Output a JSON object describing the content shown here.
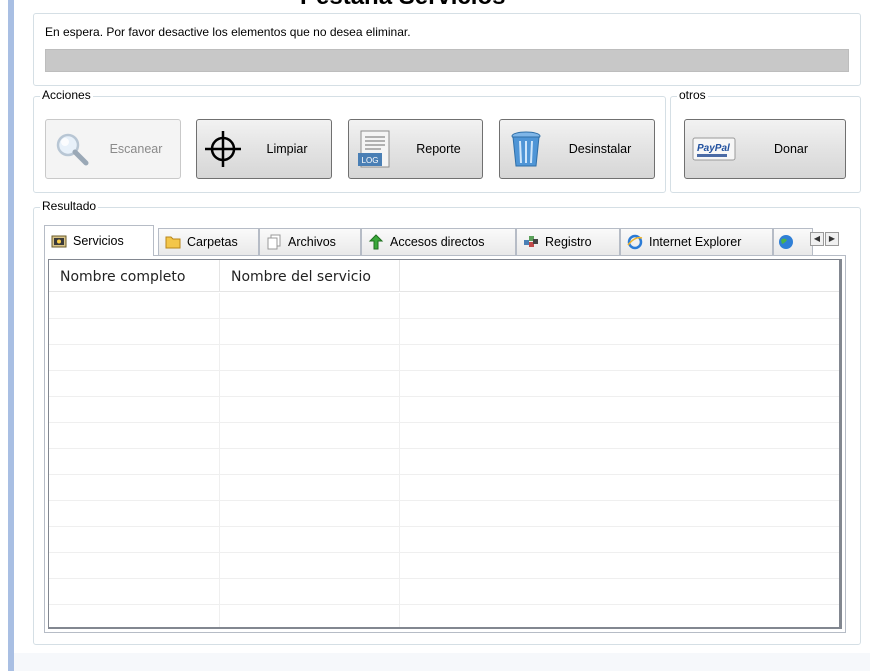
{
  "page_title": "Pestaña Servicios",
  "status": {
    "message": "En espera. Por favor desactive los elementos que no desea eliminar.",
    "progress": 0
  },
  "actions": {
    "label": "Acciones",
    "buttons": [
      {
        "label": "Escanear",
        "icon": "magnifier-icon",
        "enabled": false
      },
      {
        "label": "Limpiar",
        "icon": "crosshair-icon",
        "enabled": true
      },
      {
        "label": "Reporte",
        "icon": "log-file-icon",
        "icon_text": "LOG",
        "enabled": true
      },
      {
        "label": "Desinstalar",
        "icon": "trash-bin-icon",
        "enabled": true
      }
    ]
  },
  "others": {
    "label": "otros",
    "donate": {
      "label": "Donar",
      "icon": "paypal-icon",
      "icon_text": "PayPal"
    }
  },
  "result": {
    "label": "Resultado",
    "tabs": [
      {
        "label": "Servicios",
        "icon": "services-icon",
        "active": true
      },
      {
        "label": "Carpetas",
        "icon": "folder-icon",
        "active": false
      },
      {
        "label": "Archivos",
        "icon": "files-icon",
        "active": false
      },
      {
        "label": "Accesos directos",
        "icon": "shortcut-arrow-icon",
        "active": false
      },
      {
        "label": "Registro",
        "icon": "registry-icon",
        "active": false
      },
      {
        "label": "Internet Explorer",
        "icon": "internet-explorer-icon",
        "active": false
      }
    ],
    "table": {
      "columns": [
        "Nombre completo",
        "Nombre del servicio",
        ""
      ],
      "rows": []
    }
  },
  "colors": {
    "accent_bar": "#a9bfe3",
    "progress_bg": "#c8c8c8",
    "border": "#d5dfe5"
  }
}
